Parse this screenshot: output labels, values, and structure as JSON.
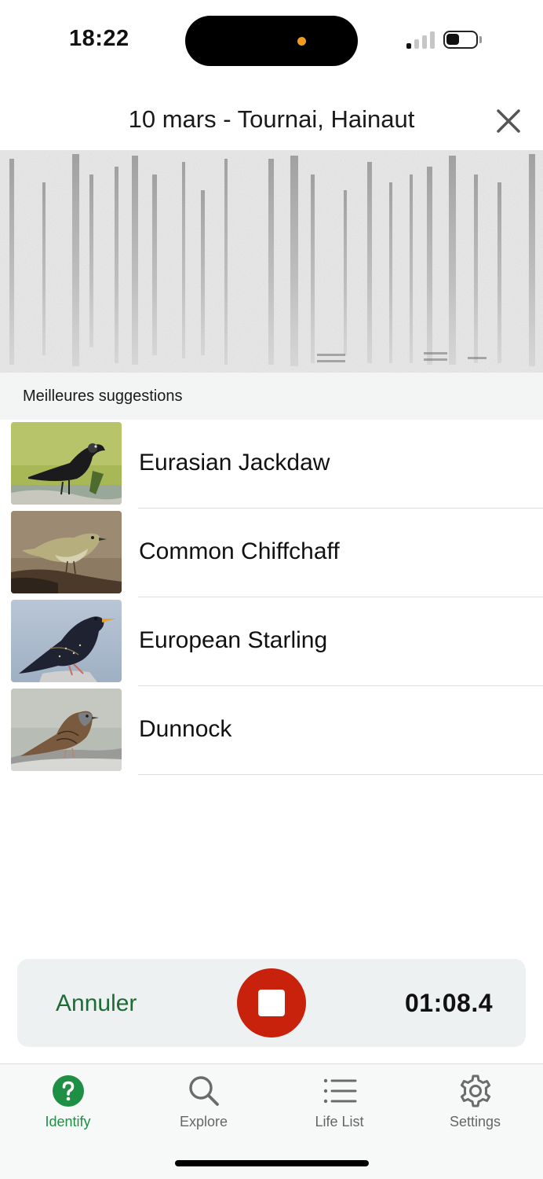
{
  "status_bar": {
    "time": "18:22",
    "signal_bars_active": 1,
    "signal_bars_total": 4,
    "battery_level": 0.45
  },
  "header": {
    "title": "10 mars - Tournai, Hainaut",
    "close_icon": "close-icon"
  },
  "suggestions": {
    "section_title": "Meilleures suggestions",
    "items": [
      {
        "label": "Eurasian Jackdaw",
        "photo": "jackdaw-photo"
      },
      {
        "label": "Common Chiffchaff",
        "photo": "chiffchaff-photo"
      },
      {
        "label": "European Starling",
        "photo": "starling-photo"
      },
      {
        "label": "Dunnock",
        "photo": "dunnock-photo"
      }
    ]
  },
  "recorder": {
    "cancel_label": "Annuler",
    "timer": "01:08.4",
    "stop_icon": "stop-icon"
  },
  "tabs": [
    {
      "label": "Identify",
      "icon": "question-icon",
      "active": true
    },
    {
      "label": "Explore",
      "icon": "search-icon",
      "active": false
    },
    {
      "label": "Life List",
      "icon": "list-icon",
      "active": false
    },
    {
      "label": "Settings",
      "icon": "gear-icon",
      "active": false
    }
  ],
  "colors": {
    "accent_green": "#1e8f45",
    "cancel_green": "#1e6b36",
    "stop_red": "#c8210c",
    "island_dot_orange": "#f59b1b"
  }
}
